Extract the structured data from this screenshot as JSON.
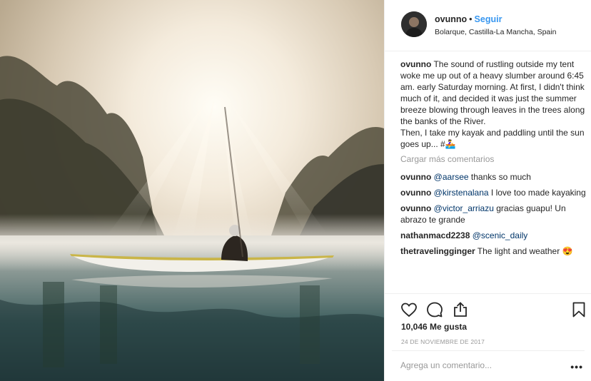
{
  "post": {
    "username": "ovunno",
    "separator": "•",
    "follow_label": "Seguir",
    "location": "Bolarque, Castilla-La Mancha, Spain",
    "caption_user": "ovunno",
    "caption_text": "The sound of rustling outside my tent woke me up out of a heavy slumber around 6:45 am. early Saturday morning. At first, I didn't think much of it, and decided it was just the summer breeze blowing through leaves in the trees along the banks of the River.",
    "caption_text2": "Then, I take my kayak and paddling until the sun goes up... #🚣‍♀️",
    "load_more": "Cargar más comentarios",
    "comments": [
      {
        "user": "ovunno",
        "mention": "@aarsee",
        "text": " thanks so much"
      },
      {
        "user": "ovunno",
        "mention": "@kirstenalana",
        "text": " I love too made kayaking"
      },
      {
        "user": "ovunno",
        "mention": "@victor_arriazu",
        "text": " gracias guapu! Un abrazo te grande"
      },
      {
        "user": "nathanmacd2238",
        "mention": "@scenic_daily",
        "text": ""
      },
      {
        "user": "thetravelingginger",
        "mention": "",
        "text": " The light and weather 😍"
      }
    ],
    "likes": "10,046 Me gusta",
    "date": "24 DE NOVIEMBRE DE 2017",
    "comment_placeholder": "Agrega un comentario...",
    "more_label": "•••"
  },
  "icons": {
    "like": "heart-icon",
    "comment": "comment-bubble-icon",
    "share": "share-icon",
    "save": "bookmark-icon"
  },
  "colors": {
    "follow": "#3897f0",
    "mention": "#003569",
    "muted": "#999999",
    "text": "#262626"
  }
}
